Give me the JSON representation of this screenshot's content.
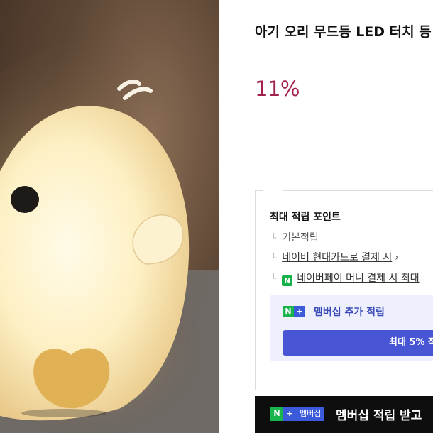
{
  "product": {
    "title": "아기 오리 무드등 LED 터치 등",
    "discount_rate": "11%"
  },
  "points": {
    "title": "최대 적립 포인트",
    "rows": [
      "기본적립",
      "네이버 현대카드로 결제 시",
      "네이버페이 머니 결제 시 최대"
    ],
    "chevron": "›",
    "npay_badge": "N",
    "membership": {
      "logo_n": "N",
      "logo_plus": "+",
      "label": "멤버십 추가 적립",
      "button": "최대 5% 적"
    }
  },
  "banner": {
    "logo_n": "N",
    "logo_plus": "+",
    "logo_text": "멤버십",
    "text": "멤버십 적립 받고"
  },
  "icons": {
    "branch": "└",
    "image": "duck-lamp-image"
  },
  "colors": {
    "discount": "#a3214a",
    "naver_green": "#19b54d",
    "membership_blue": "#4855d4"
  }
}
